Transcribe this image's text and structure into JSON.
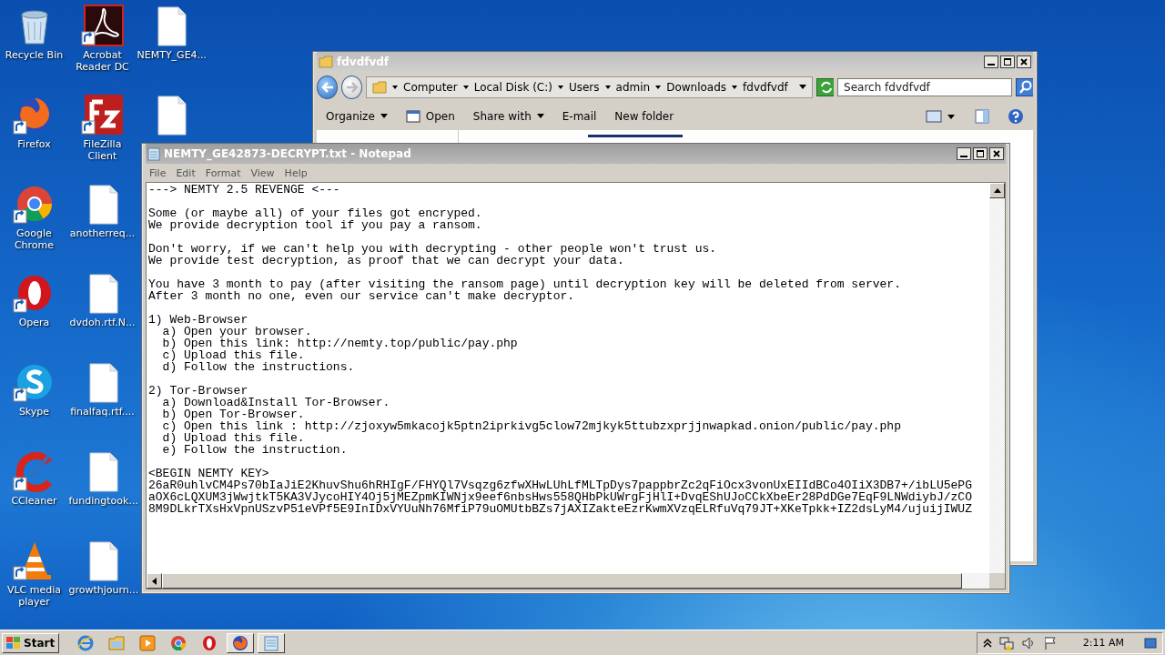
{
  "desktop_icons": [
    {
      "label": "Recycle Bin",
      "kind": "recycle",
      "shortcut": false
    },
    {
      "label": "Firefox",
      "kind": "firefox",
      "shortcut": true
    },
    {
      "label": "Google Chrome",
      "kind": "chrome",
      "shortcut": true
    },
    {
      "label": "Opera",
      "kind": "opera",
      "shortcut": true
    },
    {
      "label": "Skype",
      "kind": "skype",
      "shortcut": true
    },
    {
      "label": "CCleaner",
      "kind": "ccleaner",
      "shortcut": true
    },
    {
      "label": "VLC media player",
      "kind": "vlc",
      "shortcut": true
    },
    {
      "label": "Acrobat Reader DC",
      "kind": "acrobat",
      "shortcut": true
    },
    {
      "label": "FileZilla Client",
      "kind": "filezilla",
      "shortcut": true
    },
    {
      "label": "anotherreq...",
      "kind": "file",
      "shortcut": false
    },
    {
      "label": "dvdoh.rtf.N...",
      "kind": "file",
      "shortcut": false
    },
    {
      "label": "finalfaq.rtf....",
      "kind": "file",
      "shortcut": false
    },
    {
      "label": "fundingtook...",
      "kind": "file",
      "shortcut": false
    },
    {
      "label": "growthjourn...",
      "kind": "file",
      "shortcut": false
    },
    {
      "label": "NEMTY_GE4...",
      "kind": "file",
      "shortcut": false
    },
    {
      "kind": "file",
      "shortcut": false
    }
  ],
  "explorer": {
    "title": "fdvdfvdf",
    "breadcrumbs": [
      "Computer",
      "Local Disk (C:)",
      "Users",
      "admin",
      "Downloads",
      "fdvdfvdf"
    ],
    "search": {
      "placeholder": "Search fdvdfvdf"
    },
    "toolbar": [
      {
        "label": "Organize",
        "kind": "menu"
      },
      {
        "label": "Open",
        "kind": "icon"
      },
      {
        "label": "Share with",
        "kind": "menu"
      },
      {
        "label": "E-mail",
        "kind": "plain"
      },
      {
        "label": "New folder",
        "kind": "plain"
      }
    ]
  },
  "notepad": {
    "title": "NEMTY_GE42873-DECRYPT.txt - Notepad",
    "menu": [
      "File",
      "Edit",
      "Format",
      "View",
      "Help"
    ],
    "paragraphs": [
      [
        "---> NEMTY 2.5 REVENGE <---"
      ],
      [
        "Some (or maybe all) of your files got encryped.",
        "We provide decryption tool if you pay a ransom."
      ],
      [
        "Don't worry, if we can't help you with decrypting - other people won't trust us.",
        "We provide test decryption, as proof that we can decrypt your data."
      ],
      [
        "You have 3 month to pay (after visiting the ransom page) until decryption key will be deleted from server.",
        "After 3 month no one, even our service can't make decryptor."
      ],
      [
        "1) Web-Browser",
        "  a) Open your browser.",
        "  b) Open this link: http://nemty.top/public/pay.php",
        "  c) Upload this file.",
        "  d) Follow the instructions."
      ],
      [
        "2) Tor-Browser",
        "  a) Download&Install Tor-Browser.",
        "  b) Open Tor-Browser.",
        "  c) Open this link : http://zjoxyw5mkacojk5ptn2iprkivg5clow72mjkyk5ttubzxprjjnwapkad.onion/public/pay.php",
        "  d) Upload this file.",
        "  e) Follow the instruction."
      ],
      [
        "<BEGIN NEMTY KEY>",
        "26aR0uhlvCM4Ps70bIaJiE2KhuvShu6hRHIgF/FHYQl7Vsqzg6zfwXHwLUhLfMLTpDys7pappbrZc2qFiOcx3vonUxEIIdBCo4OIiX3DB7+/ibLU5ePG",
        "aOX6cLQXUM3jWwjtkT5KA3VJycoHIY4Oj5jMEZpmKIWNjx9eef6nbsHws558QHbPkUWrgFjHlI+DvqEShUJoCCkXbeEr28PdDGe7EqF9LNWdiybJ/zCO",
        "8M9DLkrTXsHxVpnUSzvP51eVPf5E9InIDxVYUuNh76MfiP79uOMUtbBZs7jAXIZakteEzrKwmXVzqELRfuVq79JT+XKeTpkk+IZ2dsLyM4/ujuijIWUZ"
      ]
    ]
  },
  "taskbar": {
    "start": "Start",
    "items": [
      {
        "kind": "ie",
        "open": false
      },
      {
        "kind": "folder",
        "open": false
      },
      {
        "kind": "media",
        "open": false
      },
      {
        "kind": "chrome",
        "open": false
      },
      {
        "kind": "opera",
        "open": false
      },
      {
        "kind": "firefox",
        "open": true
      },
      {
        "kind": "notepad",
        "open": true
      }
    ],
    "clock": "2:11 AM"
  }
}
